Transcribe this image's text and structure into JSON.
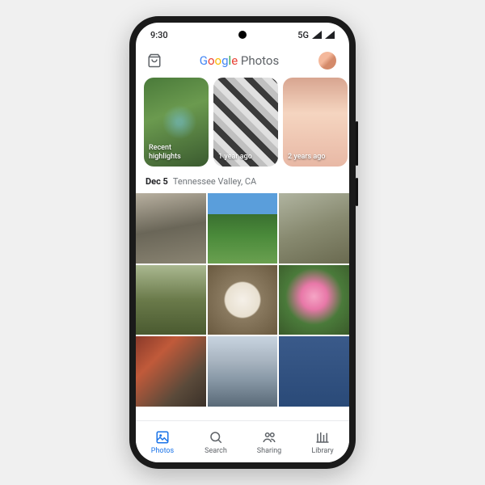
{
  "status_bar": {
    "time": "9:30",
    "network": "5G"
  },
  "header": {
    "title_google": "Google",
    "title_photos": " Photos"
  },
  "memories": [
    {
      "label": "Recent highlights"
    },
    {
      "label": "1 year ago"
    },
    {
      "label": "2 years ago"
    }
  ],
  "section": {
    "date": "Dec 5",
    "location": "Tennessee Valley, CA"
  },
  "nav": {
    "photos": "Photos",
    "search": "Search",
    "sharing": "Sharing",
    "library": "Library"
  }
}
